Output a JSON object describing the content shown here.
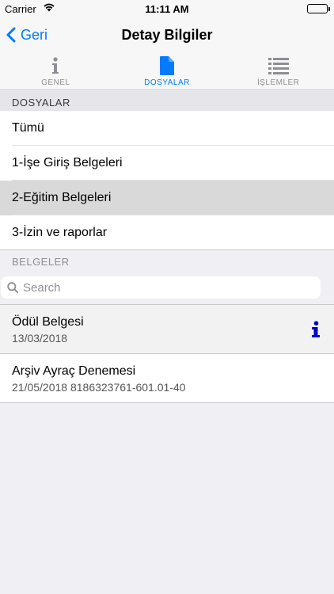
{
  "status_bar": {
    "carrier": "Carrier",
    "time": "11:11 AM"
  },
  "nav": {
    "back_label": "Geri",
    "title": "Detay Bilgiler"
  },
  "tabs": [
    {
      "label": "GENEL",
      "icon": "info-icon",
      "active": false
    },
    {
      "label": "DOSYALAR",
      "icon": "document-icon",
      "active": true
    },
    {
      "label": "İŞLEMLER",
      "icon": "list-icon",
      "active": false
    }
  ],
  "folders_header": "DOSYALAR",
  "folders": [
    {
      "label": "Tümü"
    },
    {
      "label": "1-İşe Giriş Belgeleri"
    },
    {
      "label": "2-Eğitim Belgeleri",
      "selected": true
    },
    {
      "label": "3-İzin ve raporlar"
    }
  ],
  "documents_header": "BELGELER",
  "search": {
    "placeholder": "Search",
    "value": ""
  },
  "documents": [
    {
      "title": "Ödül Belgesi",
      "subtitle": "13/03/2018",
      "has_info": true
    },
    {
      "title": "Arşiv Ayraç Denemesi",
      "subtitle": "21/05/2018 8186323761-601.01-40",
      "has_info": false
    }
  ],
  "colors": {
    "accent": "#007aff",
    "info_icon": "#0000cc",
    "selected_row": "#d9d9d9"
  }
}
